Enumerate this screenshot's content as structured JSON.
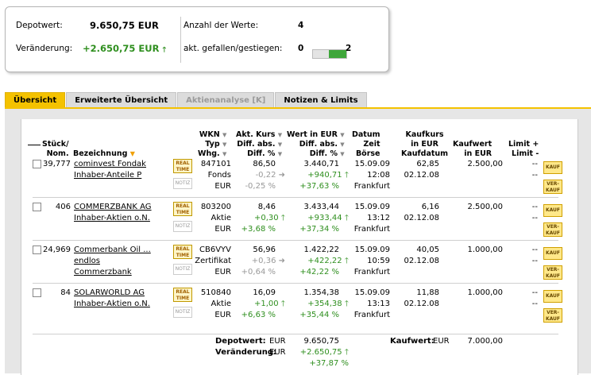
{
  "summary": {
    "depotwert_label": "Depotwert:",
    "depotwert": "9.650,75 EUR",
    "veraenderung_label": "Veränderung:",
    "veraenderung": "+2.650,75 EUR",
    "anzahl_label": "Anzahl der Werte:",
    "anzahl": "4",
    "gefallen_label": "akt. gefallen/gestiegen:",
    "gefallen": "0",
    "gestiegen": "2",
    "up_arrow": "🡑"
  },
  "tabs": [
    "Übersicht",
    "Erweiterte Übersicht",
    "Aktienanalyse [K]",
    "Notizen & Limits"
  ],
  "headers": {
    "stueck": [
      "Stück/",
      "Nom."
    ],
    "bezeichnung": "Bezeichnung",
    "wkn": [
      "WKN",
      "Typ",
      "Whg."
    ],
    "kurs": [
      "Akt. Kurs",
      "Diff. abs.",
      "Diff. %"
    ],
    "wert": [
      "Wert in EUR",
      "Diff. abs.",
      "Diff. %"
    ],
    "datum": [
      "Datum",
      "Zeit",
      "Börse"
    ],
    "kaufkurs": [
      "Kaufkurs",
      "in EUR",
      "Kaufdatum"
    ],
    "kaufwert": [
      "Kaufwert",
      "in EUR"
    ],
    "limit": [
      "Limit +",
      "Limit -"
    ]
  },
  "buttons": {
    "realtime": [
      "REAL",
      "TIME"
    ],
    "notiz": "NOTIZ",
    "kauf": "KAUF",
    "verkauf": [
      "VER-",
      "KAUF"
    ]
  },
  "rows": [
    {
      "stueck": "39,777",
      "name": [
        "cominvest Fondak",
        "Inhaber-Anteile P"
      ],
      "wkn": "847101",
      "typ": "Fonds",
      "whg": "EUR",
      "kurs": "86,50",
      "kdiff": "-0,22 ➜",
      "kpct": "-0,25 %",
      "wert": "3.440,71",
      "wdiff": "+940,71 🡑",
      "wpct": "+37,63 %",
      "datum": "15.09.09",
      "zeit": "12:08",
      "boerse": "Frankfurt",
      "kaufkurs": "62,85",
      "kaufdatum": "02.12.08",
      "kaufwert": "2.500,00",
      "limit1": "--",
      "limit2": "--",
      "kgreen": false
    },
    {
      "stueck": "406",
      "name": [
        "COMMERZBANK AG",
        "Inhaber-Aktien o.N."
      ],
      "wkn": "803200",
      "typ": "Aktie",
      "whg": "EUR",
      "kurs": "8,46",
      "kdiff": "+0,30 🡑",
      "kpct": "+3,68 %",
      "wert": "3.433,44",
      "wdiff": "+933,44 🡑",
      "wpct": "+37,34 %",
      "datum": "15.09.09",
      "zeit": "13:12",
      "boerse": "Frankfurt",
      "kaufkurs": "6,16",
      "kaufdatum": "02.12.08",
      "kaufwert": "2.500,00",
      "limit1": "--",
      "limit2": "--",
      "kgreen": true
    },
    {
      "stueck": "24,969",
      "name": [
        "Commerbank Oil ...",
        "endlos",
        "Commerzbank"
      ],
      "wkn": "CB6VYV",
      "typ": "Zertifikat",
      "whg": "EUR",
      "kurs": "56,96",
      "kdiff": "+0,36 ➜",
      "kpct": "+0,64 %",
      "wert": "1.422,22",
      "wdiff": "+422,22 🡑",
      "wpct": "+42,22 %",
      "datum": "15.09.09",
      "zeit": "10:59",
      "boerse": "Frankfurt",
      "kaufkurs": "40,05",
      "kaufdatum": "02.12.08",
      "kaufwert": "1.000,00",
      "limit1": "--",
      "limit2": "--",
      "kgreen": false
    },
    {
      "stueck": "84",
      "name": [
        "SOLARWORLD AG",
        "Inhaber-Aktien o.N."
      ],
      "wkn": "510840",
      "typ": "Aktie",
      "whg": "EUR",
      "kurs": "16,09",
      "kdiff": "+1,00 🡑",
      "kpct": "+6,63 %",
      "wert": "1.354,38",
      "wdiff": "+354,38 🡑",
      "wpct": "+35,44 %",
      "datum": "15.09.09",
      "zeit": "13:13",
      "boerse": "Frankfurt",
      "kaufkurs": "11,88",
      "kaufdatum": "02.12.08",
      "kaufwert": "1.000,00",
      "limit1": "--",
      "limit2": "--",
      "kgreen": true
    }
  ],
  "footer": {
    "depotwert_label": "Depotwert:",
    "veraenderung_label": "Veränderung:",
    "cur1": "EUR",
    "cur2": "EUR",
    "wert": "9.650,75",
    "diff": "+2.650,75 🡑",
    "pct": "+37,87 %",
    "kaufwert_label": "Kaufwert:",
    "kaufwert_cur": "EUR",
    "kaufwert": "7.000,00"
  },
  "colors": {
    "accent": "#f4c200",
    "positive": "#2f8f1f",
    "neutral": "#999999"
  }
}
